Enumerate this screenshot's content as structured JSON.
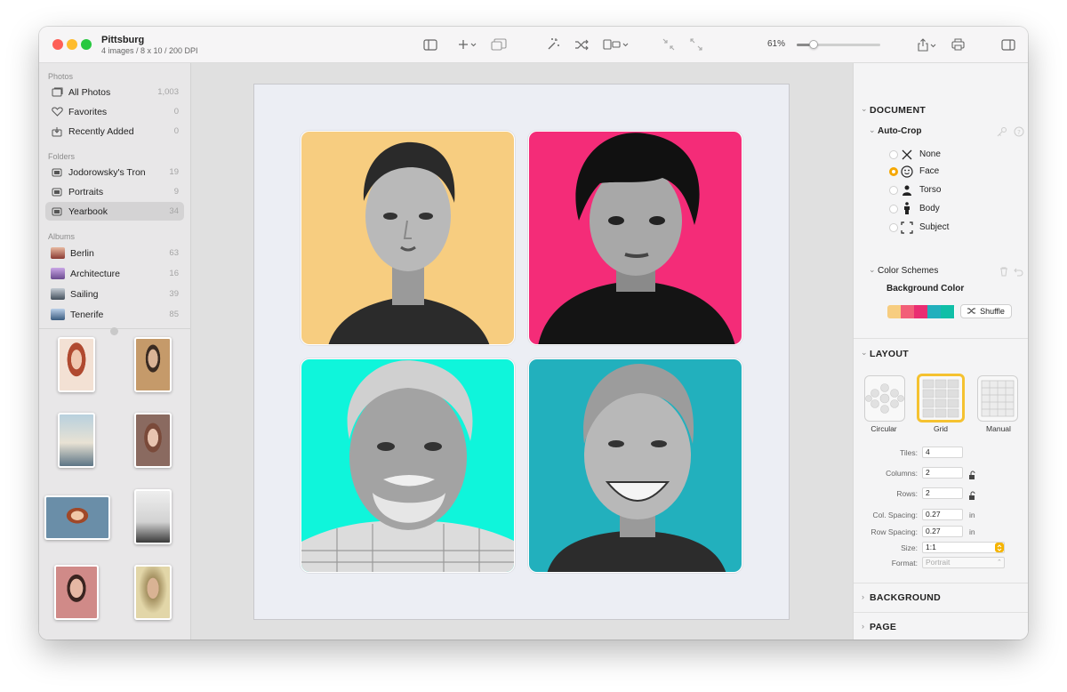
{
  "window": {
    "title": "Pittsburg",
    "subtitle": "4 images / 8 x 10 / 200 DPI"
  },
  "toolbar": {
    "zoom_label": "61%",
    "zoom_fraction": 0.2
  },
  "sidebar": {
    "photos_header": "Photos",
    "photos": [
      {
        "label": "All Photos",
        "count": "1,003",
        "icon": "photos-icon"
      },
      {
        "label": "Favorites",
        "count": "0",
        "icon": "heart-icon"
      },
      {
        "label": "Recently Added",
        "count": "0",
        "icon": "recently-added-icon"
      }
    ],
    "folders_header": "Folders",
    "folders": [
      {
        "label": "Jodorowsky's Tron",
        "count": "19",
        "icon": "folder-icon"
      },
      {
        "label": "Portraits",
        "count": "9",
        "icon": "folder-icon"
      },
      {
        "label": "Yearbook",
        "count": "34",
        "icon": "folder-icon",
        "selected": true
      }
    ],
    "albums_header": "Albums",
    "albums": [
      {
        "label": "Berlin",
        "count": "63",
        "color": "#b65a52"
      },
      {
        "label": "Architecture",
        "count": "16",
        "color": "#9a6ec2"
      },
      {
        "label": "Sailing",
        "count": "39",
        "color": "#6d7d8c"
      },
      {
        "label": "Tenerife",
        "count": "85",
        "color": "#5c7fa8"
      }
    ]
  },
  "canvas": {
    "tile_colors": [
      "#f7cd80",
      "#f42c78",
      "#0ff5db",
      "#22b0bd"
    ]
  },
  "inspector": {
    "document_header": "DOCUMENT",
    "autocrop_label": "Auto-Crop",
    "autocrop_options": [
      {
        "label": "None",
        "icon": "x-icon",
        "selected": false
      },
      {
        "label": "Face",
        "icon": "face-icon",
        "selected": true
      },
      {
        "label": "Torso",
        "icon": "torso-icon",
        "selected": false
      },
      {
        "label": "Body",
        "icon": "body-icon",
        "selected": false
      },
      {
        "label": "Subject",
        "icon": "subject-icon",
        "selected": false
      }
    ],
    "color_schemes_label": "Color Schemes",
    "background_color_label": "Background Color",
    "palette": [
      "#f7cd80",
      "#f25f78",
      "#ea2d72",
      "#22b0bd",
      "#10bfa7"
    ],
    "shuffle_label": "Shuffle",
    "layout_header": "LAYOUT",
    "layouts": [
      {
        "label": "Circular",
        "selected": false
      },
      {
        "label": "Grid",
        "selected": true
      },
      {
        "label": "Manual",
        "selected": false
      }
    ],
    "fields": {
      "tiles_label": "Tiles:",
      "tiles_value": "4",
      "columns_label": "Columns:",
      "columns_value": "2",
      "rows_label": "Rows:",
      "rows_value": "2",
      "col_spacing_label": "Col. Spacing:",
      "col_spacing_value": "0.27",
      "col_spacing_unit": "in",
      "row_spacing_label": "Row Spacing:",
      "row_spacing_value": "0.27",
      "row_spacing_unit": "in",
      "size_label": "Size:",
      "size_value": "1:1",
      "format_label": "Format:",
      "format_value": "Portrait"
    },
    "background_header": "BACKGROUND",
    "page_header": "PAGE"
  },
  "colors": {
    "accent": "#f5a700",
    "selected_layout_border": "#f5c230"
  }
}
